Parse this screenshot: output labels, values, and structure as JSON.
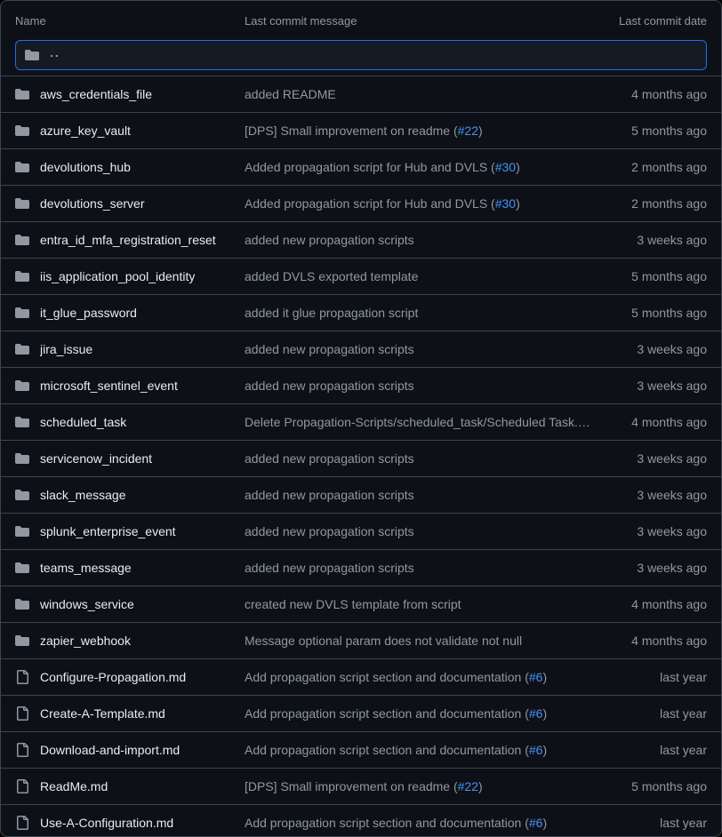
{
  "columns": {
    "name": "Name",
    "message": "Last commit message",
    "date": "Last commit date"
  },
  "parent": {
    "label": ".."
  },
  "rows": [
    {
      "kind": "dir",
      "name": "aws_credentials_file",
      "msg": "added README",
      "link": null,
      "date": "4 months ago"
    },
    {
      "kind": "dir",
      "name": "azure_key_vault",
      "msg": "[DPS] Small improvement on readme (",
      "link": "#22",
      "date": "5 months ago"
    },
    {
      "kind": "dir",
      "name": "devolutions_hub",
      "msg": "Added propagation script for Hub and DVLS (",
      "link": "#30",
      "date": "2 months ago"
    },
    {
      "kind": "dir",
      "name": "devolutions_server",
      "msg": "Added propagation script for Hub and DVLS (",
      "link": "#30",
      "date": "2 months ago"
    },
    {
      "kind": "dir",
      "name": "entra_id_mfa_registration_reset",
      "msg": "added new propagation scripts",
      "link": null,
      "date": "3 weeks ago"
    },
    {
      "kind": "dir",
      "name": "iis_application_pool_identity",
      "msg": "added DVLS exported template",
      "link": null,
      "date": "5 months ago"
    },
    {
      "kind": "dir",
      "name": "it_glue_password",
      "msg": "added it glue propagation script",
      "link": null,
      "date": "5 months ago"
    },
    {
      "kind": "dir",
      "name": "jira_issue",
      "msg": "added new propagation scripts",
      "link": null,
      "date": "3 weeks ago"
    },
    {
      "kind": "dir",
      "name": "microsoft_sentinel_event",
      "msg": "added new propagation scripts",
      "link": null,
      "date": "3 weeks ago"
    },
    {
      "kind": "dir",
      "name": "scheduled_task",
      "msg": "Delete Propagation-Scripts/scheduled_task/Scheduled Task.json",
      "link": null,
      "date": "4 months ago"
    },
    {
      "kind": "dir",
      "name": "servicenow_incident",
      "msg": "added new propagation scripts",
      "link": null,
      "date": "3 weeks ago"
    },
    {
      "kind": "dir",
      "name": "slack_message",
      "msg": "added new propagation scripts",
      "link": null,
      "date": "3 weeks ago"
    },
    {
      "kind": "dir",
      "name": "splunk_enterprise_event",
      "msg": "added new propagation scripts",
      "link": null,
      "date": "3 weeks ago"
    },
    {
      "kind": "dir",
      "name": "teams_message",
      "msg": "added new propagation scripts",
      "link": null,
      "date": "3 weeks ago"
    },
    {
      "kind": "dir",
      "name": "windows_service",
      "msg": "created new DVLS template from script",
      "link": null,
      "date": "4 months ago"
    },
    {
      "kind": "dir",
      "name": "zapier_webhook",
      "msg": "Message optional param does not validate not null",
      "link": null,
      "date": "4 months ago"
    },
    {
      "kind": "file",
      "name": "Configure-Propagation.md",
      "msg": "Add propagation script section and documentation (",
      "link": "#6",
      "date": "last year"
    },
    {
      "kind": "file",
      "name": "Create-A-Template.md",
      "msg": "Add propagation script section and documentation (",
      "link": "#6",
      "date": "last year"
    },
    {
      "kind": "file",
      "name": "Download-and-import.md",
      "msg": "Add propagation script section and documentation (",
      "link": "#6",
      "date": "last year"
    },
    {
      "kind": "file",
      "name": "ReadMe.md",
      "msg": "[DPS] Small improvement on readme (",
      "link": "#22",
      "date": "5 months ago"
    },
    {
      "kind": "file",
      "name": "Use-A-Configuration.md",
      "msg": "Add propagation script section and documentation (",
      "link": "#6",
      "date": "last year"
    }
  ]
}
